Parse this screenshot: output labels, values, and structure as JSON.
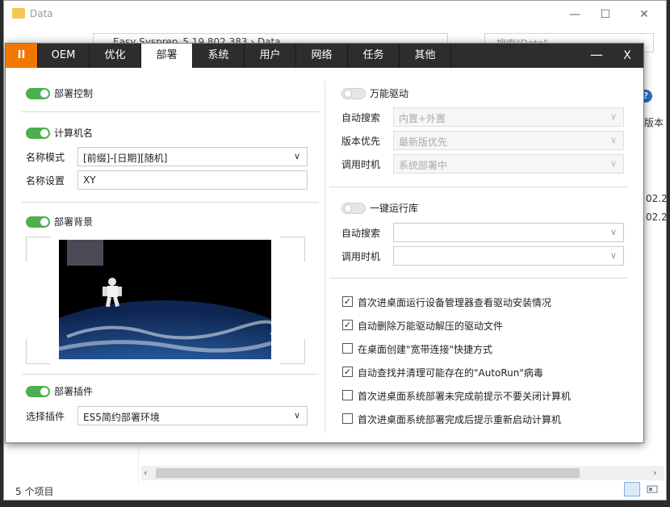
{
  "explorer": {
    "title": "Data",
    "address": "Easy Sysprep_5.19.802.383 › Data",
    "search_placeholder": "搜索\"Data\"",
    "col_partial": "版本",
    "date1": "02.2",
    "date2": "02.2",
    "status": "5 个项目",
    "minimize": "—",
    "maximize": "☐",
    "close": "✕"
  },
  "dialog": {
    "tabs": [
      {
        "id": "pause",
        "label": "II"
      },
      {
        "id": "oem",
        "label": "OEM"
      },
      {
        "id": "optimize",
        "label": "优化"
      },
      {
        "id": "deploy",
        "label": "部署",
        "active": true
      },
      {
        "id": "system",
        "label": "系统"
      },
      {
        "id": "user",
        "label": "用户"
      },
      {
        "id": "network",
        "label": "网络"
      },
      {
        "id": "task",
        "label": "任务"
      },
      {
        "id": "other",
        "label": "其他"
      }
    ],
    "minimize_label": "—",
    "close_label": "X",
    "left": {
      "deploy_control": {
        "label": "部署控制",
        "on": true
      },
      "computer_name": {
        "label": "计算机名",
        "on": true,
        "mode_label": "名称模式",
        "mode_value": "[前缀]-[日期][随机]",
        "name_label": "名称设置",
        "name_value": "XY"
      },
      "background": {
        "label": "部署背景",
        "on": true
      },
      "plugin": {
        "label": "部署插件",
        "on": true,
        "select_label": "选择插件",
        "select_value": "ES5简约部署环境"
      }
    },
    "right": {
      "driver": {
        "label": "万能驱动",
        "on": false,
        "auto_search_label": "自动搜索",
        "auto_search_value": "内置+外置",
        "version_label": "版本优先",
        "version_value": "最新版优先",
        "timing_label": "调用时机",
        "timing_value": "系统部署中"
      },
      "runtime": {
        "label": "一键运行库",
        "on": false,
        "auto_search_label": "自动搜索",
        "auto_search_value": "",
        "timing_label": "调用时机",
        "timing_value": ""
      },
      "checks": [
        {
          "label": "首次进桌面运行设备管理器查看驱动安装情况",
          "checked": true
        },
        {
          "label": "自动删除万能驱动解压的驱动文件",
          "checked": true
        },
        {
          "label": "在桌面创建\"宽带连接\"快捷方式",
          "checked": false
        },
        {
          "label": "自动查找并清理可能存在的\"AutoRun\"病毒",
          "checked": true
        },
        {
          "label": "首次进桌面系统部署未完成前提示不要关闭计算机",
          "checked": false
        },
        {
          "label": "首次进桌面系统部署完成后提示重新启动计算机",
          "checked": false
        }
      ]
    }
  }
}
